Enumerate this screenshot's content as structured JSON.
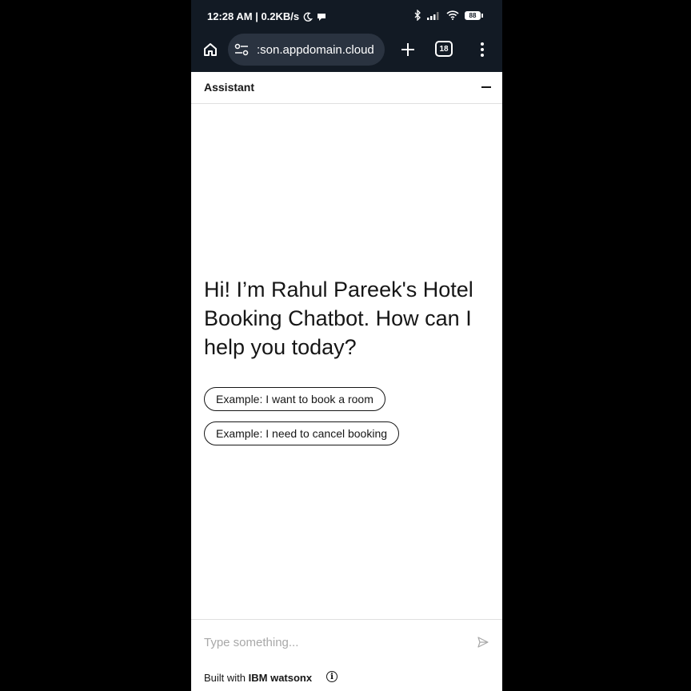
{
  "status_bar": {
    "time_speed": "12:28 AM | 0.2KB/s",
    "battery": "88"
  },
  "browser": {
    "url": ":son.appdomain.cloud",
    "tab_count": "18",
    "icons": [
      "home-icon",
      "site-settings-icon",
      "plus-icon",
      "tabs-icon",
      "more-vert-icon"
    ]
  },
  "assistant": {
    "title": "Assistant",
    "greeting": "Hi! I’m Rahul Pareek's Hotel Booking Chatbot. How can I help you today?",
    "suggestions": [
      "Example: I want to book a room",
      "Example: I need to cancel booking"
    ],
    "input_placeholder": "Type something...",
    "footer_prefix": "Built with ",
    "footer_brand": "IBM watsonx"
  },
  "colors": {
    "chrome_bg": "#121a24",
    "url_pill_bg": "#2a3340",
    "text_primary": "#161616",
    "placeholder": "#a8a8a8"
  }
}
